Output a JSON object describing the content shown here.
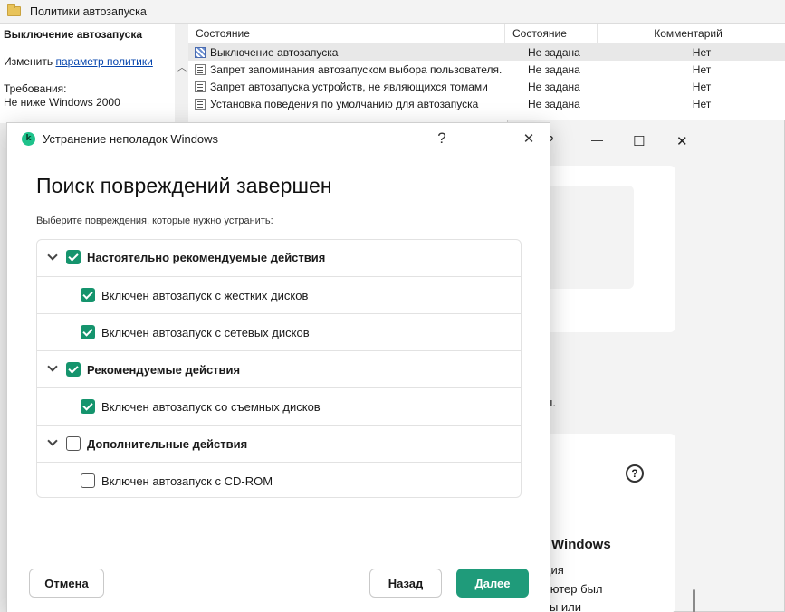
{
  "gp_window": {
    "title": "Политики автозапуска",
    "policy_name": "Выключение автозапуска",
    "edit_prefix": "Изменить",
    "edit_link": "параметр политики",
    "requirements_label": "Требования:",
    "requirements_value": "Не ниже Windows 2000",
    "columns": [
      "Состояние",
      "Состояние",
      "Комментарий"
    ],
    "rows": [
      {
        "name": "Выключение автозапуска",
        "state": "Не задана",
        "comment": "Нет"
      },
      {
        "name": "Запрет запоминания автозапуском выбора пользователя.",
        "state": "Не задана",
        "comment": "Нет"
      },
      {
        "name": "Запрет автозапуска устройств, не являющихся томами",
        "state": "Не задана",
        "comment": "Нет"
      },
      {
        "name": "Установка поведения по умолчанию для автозапуска",
        "state": "Не задана",
        "comment": "Нет"
      }
    ]
  },
  "bg_window": {
    "help_glyph": "?",
    "min_glyph": "—",
    "max_glyph": "☐",
    "close_glyph": "✕",
    "fragment_1": "ы.",
    "fragment_2": "Windows",
    "fragment_3": "ция",
    "fragment_4": "ьютер был",
    "fragment_5": "ты или"
  },
  "dialog": {
    "title": "Устранение неполадок Windows",
    "logo_letter": "k",
    "help_glyph": "?",
    "close_glyph": "✕",
    "heading": "Поиск повреждений завершен",
    "subtitle": "Выберите повреждения, которые нужно устранить:",
    "groups": [
      {
        "label": "Настоятельно рекомендуемые действия",
        "checked": true,
        "items": [
          {
            "label": "Включен автозапуск с жестких дисков",
            "checked": true
          },
          {
            "label": "Включен автозапуск с сетевых дисков",
            "checked": true
          }
        ]
      },
      {
        "label": "Рекомендуемые действия",
        "checked": true,
        "items": [
          {
            "label": "Включен автозапуск со съемных дисков",
            "checked": true
          }
        ]
      },
      {
        "label": "Дополнительные действия",
        "checked": false,
        "items": [
          {
            "label": "Включен автозапуск с CD-ROM",
            "checked": false
          }
        ]
      }
    ],
    "buttons": {
      "cancel": "Отмена",
      "back": "Назад",
      "next": "Далее"
    }
  },
  "colors": {
    "accent": "#1f9b7a",
    "checkbox_on": "#15946d",
    "link": "#0645ad"
  }
}
